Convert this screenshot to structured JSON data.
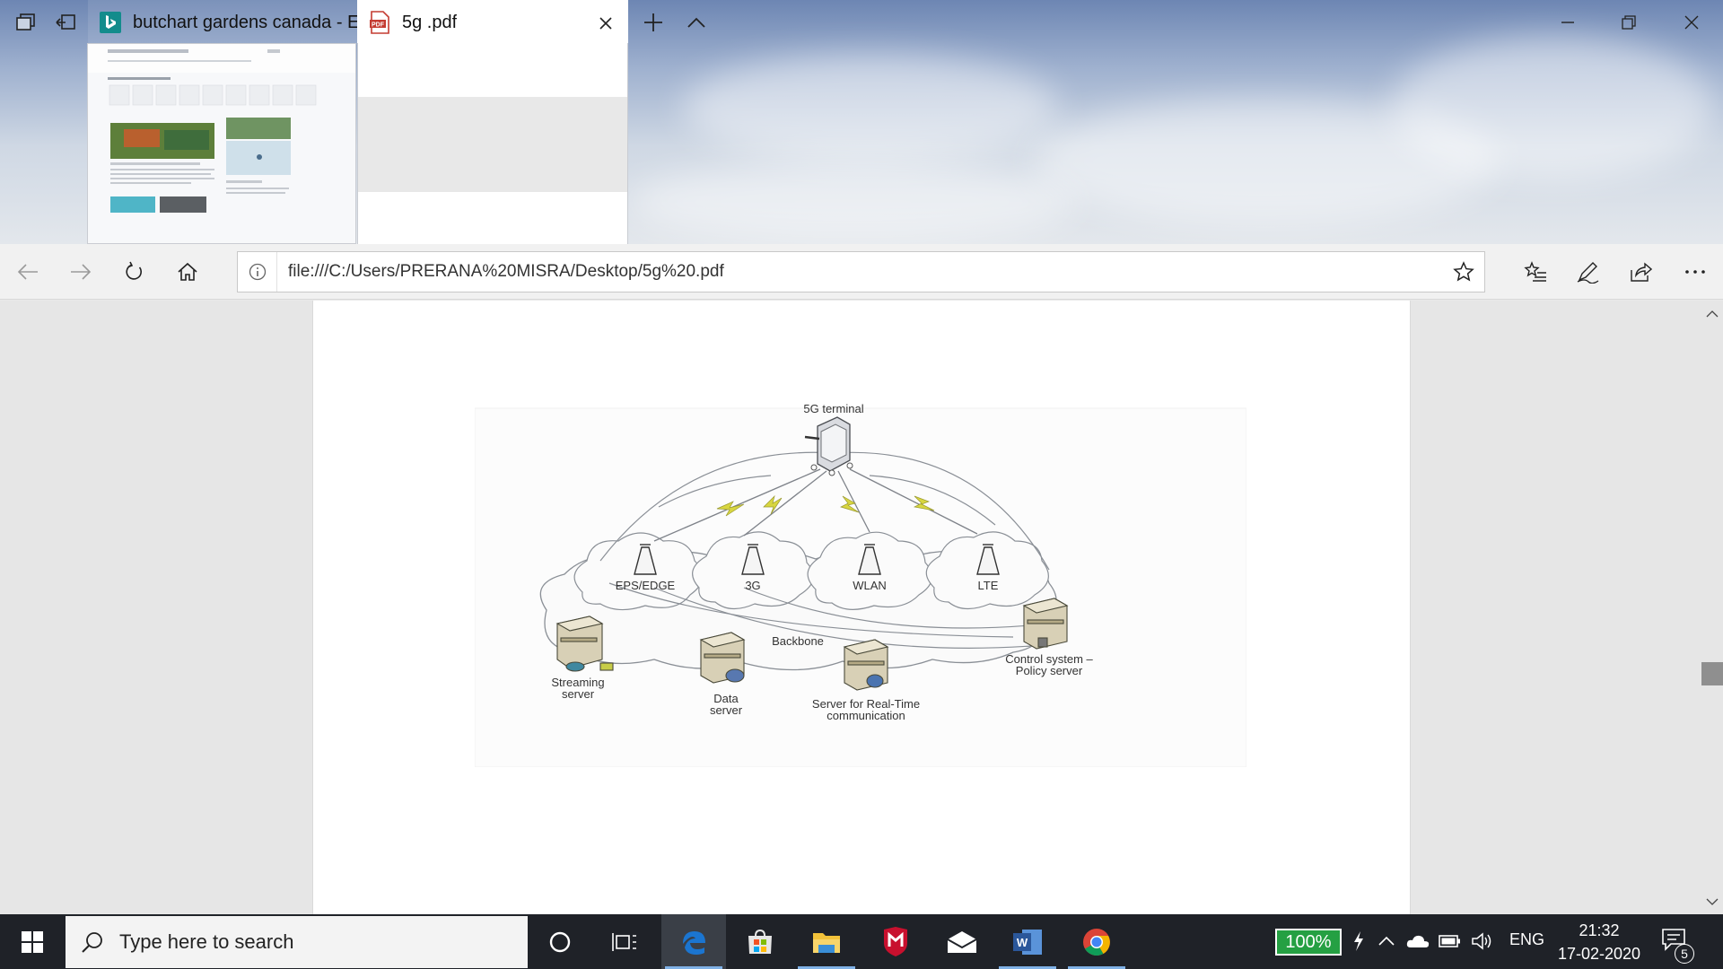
{
  "browser": {
    "tabs": [
      {
        "label": "butchart gardens canada - E",
        "favicon": "bing-icon"
      },
      {
        "label": "5g .pdf",
        "favicon": "pdf-icon"
      }
    ],
    "address": "file:///C:/Users/PRERANA%20MISRA/Desktop/5g%20.pdf"
  },
  "document": {
    "diagram_labels": {
      "gateway": "5G terminal",
      "cell1": "EPS/EDGE",
      "cell2": "3G",
      "cell3": "WLAN",
      "cell4": "LTE",
      "backbone": "Backbone",
      "streaming": "Streaming",
      "streaming2": "server",
      "data": "Data",
      "data2": "server",
      "realtime": "Server for Real-Time",
      "realtime2": "communication",
      "control": "Control system –",
      "control2": "Policy server"
    }
  },
  "taskbar": {
    "search_placeholder": "Type here to search",
    "battery_percent": "100%",
    "language": "ENG",
    "time": "21:32",
    "date": "17-02-2020",
    "notification_count": "5"
  },
  "colors": {
    "taskbar": "#1f2228",
    "battery": "#25a043",
    "edge_blue": "#1b75d0"
  }
}
